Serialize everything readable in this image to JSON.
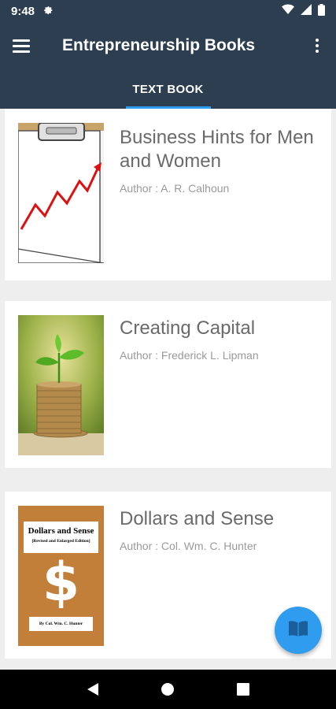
{
  "status_bar": {
    "time": "9:48"
  },
  "app_bar": {
    "title": "Entrepreneurship Books"
  },
  "tabs": [
    {
      "label": "TEXT BOOK",
      "selected": true
    }
  ],
  "books": [
    {
      "title": "Business Hints for Men and Women",
      "author": "Author : A. R. Calhoun",
      "cover": "clipboard-chart"
    },
    {
      "title": "Creating Capital",
      "author": "Author : Frederick L. Lipman",
      "cover": "plant-coins"
    },
    {
      "title": "Dollars and Sense",
      "author": "Author : Col. Wm. C. Hunter",
      "cover": "dollar-sign",
      "cover_text": {
        "title": "Dollars and Sense",
        "subtitle": "[Revised and Enlarged Edition]",
        "author": "By Col. Wm. C. Hunter"
      }
    }
  ],
  "colors": {
    "app_bar": "#2c3e50",
    "accent": "#2f9cf0",
    "title_text": "#6a6a6a",
    "author_text": "#9a9a9a",
    "cover_brown": "#c17f3a"
  }
}
